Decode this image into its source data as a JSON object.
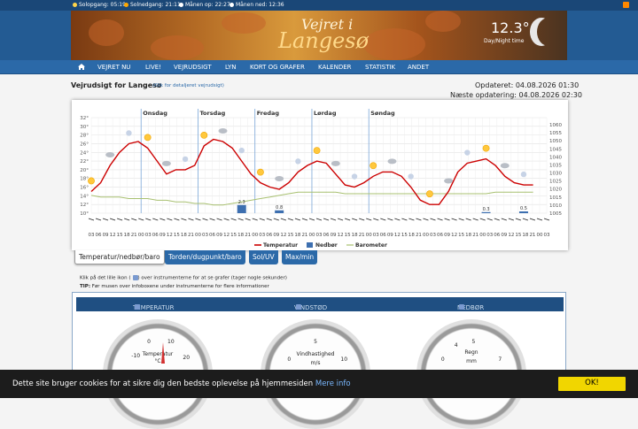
{
  "topbar": {
    "sunrise": "Solopgang: 05:19",
    "sunset": "Solnedgang: 21:11",
    "moonrise": "Månen op: 22:27",
    "moonset": "Månen ned: 12:36"
  },
  "banner": {
    "line1": "Vejret i",
    "line2": "Langesø",
    "temperature": "12.3°",
    "day_night": "Day/Night time"
  },
  "nav": {
    "items": [
      "VEJRET NU",
      "LIVE!",
      "VEJRUDSIGT",
      "LYN",
      "KORT OG GRAFER",
      "KALENDER",
      "STATISTIK",
      "ANDET"
    ]
  },
  "page": {
    "title": "Vejrudsigt for Langesø",
    "detail_link": "(Klik for detaljeret vejrudsigt)",
    "updated": "Opdateret: 04.08.2026 01:30",
    "next_update": "Næste opdatering: 04.08.2026 02:30"
  },
  "chart_data": {
    "type": "line",
    "days": [
      "Onsdag",
      "Torsdag",
      "Fredag",
      "Lørdag",
      "Søndag"
    ],
    "x_hours": [
      "03",
      "06",
      "09",
      "12",
      "15",
      "18",
      "21",
      "00",
      "03",
      "06",
      "09",
      "12",
      "15",
      "18",
      "21",
      "00",
      "03",
      "06",
      "09",
      "12",
      "15",
      "18",
      "21",
      "00",
      "03",
      "06",
      "09",
      "12",
      "15",
      "18",
      "21",
      "00",
      "03",
      "06",
      "09",
      "12",
      "15",
      "18",
      "21",
      "00",
      "03",
      "06",
      "09",
      "12",
      "15",
      "18",
      "21",
      "00",
      "03",
      "06",
      "09",
      "12",
      "15",
      "18",
      "21",
      "00",
      "03",
      "06",
      "09",
      "12",
      "15",
      "18",
      "21",
      "00",
      "03"
    ],
    "y_left_ticks": [
      "32°",
      "30°",
      "28°",
      "26°",
      "24°",
      "22°",
      "20°",
      "18°",
      "16°",
      "14°",
      "12°",
      "10°"
    ],
    "y_right_ticks": [
      "1060",
      "1055",
      "1050",
      "1045",
      "1040",
      "1035",
      "1030",
      "1025",
      "1020",
      "1015",
      "1010",
      "1005"
    ],
    "ylim_left": [
      10,
      32
    ],
    "ylim_right": [
      1003,
      1062
    ],
    "series": [
      {
        "name": "Temperatur",
        "color": "#cc0000",
        "values": [
          15,
          17,
          21,
          24,
          26,
          26.5,
          25,
          22,
          19,
          20,
          20,
          21,
          25.5,
          27,
          26.5,
          25,
          22,
          19,
          17,
          16,
          15.5,
          17,
          19.5,
          21,
          22,
          21.5,
          19,
          16.5,
          16,
          17,
          18.5,
          19.5,
          19.5,
          18.5,
          16,
          13,
          12,
          12,
          15,
          19.5,
          21.5,
          22,
          22.5,
          21,
          18.5,
          17,
          16.5,
          16.5
        ]
      },
      {
        "name": "Barometer",
        "color": "#a8c070",
        "values": [
          1014,
          1013,
          1013,
          1013,
          1012,
          1012,
          1012,
          1011,
          1011,
          1010,
          1010,
          1009,
          1009,
          1008,
          1008,
          1009,
          1010,
          1011,
          1012,
          1013,
          1014,
          1015,
          1016,
          1016,
          1016,
          1016,
          1016,
          1015,
          1015,
          1015,
          1015,
          1015,
          1015,
          1015,
          1015,
          1015,
          1015,
          1015,
          1015,
          1015,
          1015,
          1015,
          1015,
          1016,
          1016,
          1016,
          1016,
          1016
        ]
      },
      {
        "name": "Nedbør",
        "color": "#3d6fb0",
        "bars": [
          {
            "x": 16,
            "value": 2.3,
            "label": "2.3"
          },
          {
            "x": 20,
            "value": 0.8,
            "label": "0.8"
          },
          {
            "x": 42,
            "value": 0.3,
            "label": "0.3"
          },
          {
            "x": 46,
            "value": 0.5,
            "label": "0.5"
          }
        ]
      }
    ],
    "legend": "bottom-center",
    "grid": true
  },
  "tabs": [
    {
      "label": "Temperatur/nedbør/baro",
      "active": true
    },
    {
      "label": "Torden/dugpunkt/baro",
      "active": false
    },
    {
      "label": "Sol/UV",
      "active": false
    },
    {
      "label": "Max/min",
      "active": false
    }
  ],
  "help": {
    "line1_pre": "Klik på det lille ikon (",
    "line1_post": ") over instrumenterne for at se grafer (tager nogle sekunder)",
    "tip_label": "TIP:",
    "tip_text": " Før musen over infoboxene under instrumenterne for flere informationer"
  },
  "instruments": {
    "headers": [
      "TEMPERATUR",
      "VINDSTØD",
      "NEDBØR"
    ],
    "temp_gauge": {
      "label": "Temperatur",
      "unit": "°C",
      "ticks": [
        "-10",
        "0",
        "10",
        "20"
      ]
    },
    "wind_gauge": {
      "label": "Vindhastighed",
      "unit": "m/s",
      "ticks": [
        "0",
        "10",
        "5"
      ]
    },
    "rain_gauge": {
      "label": "Regn",
      "unit": "mm",
      "ticks": [
        "0",
        "4",
        "5",
        "7"
      ]
    }
  },
  "cookie": {
    "text": "Dette site bruger cookies for at sikre dig den bedste oplevelse på hjemmesiden ",
    "link": "Mere info",
    "ok": "OK!"
  },
  "colors": {
    "nav": "#2b69a8",
    "header": "#1a4777",
    "cookie_ok": "#f1d600"
  }
}
